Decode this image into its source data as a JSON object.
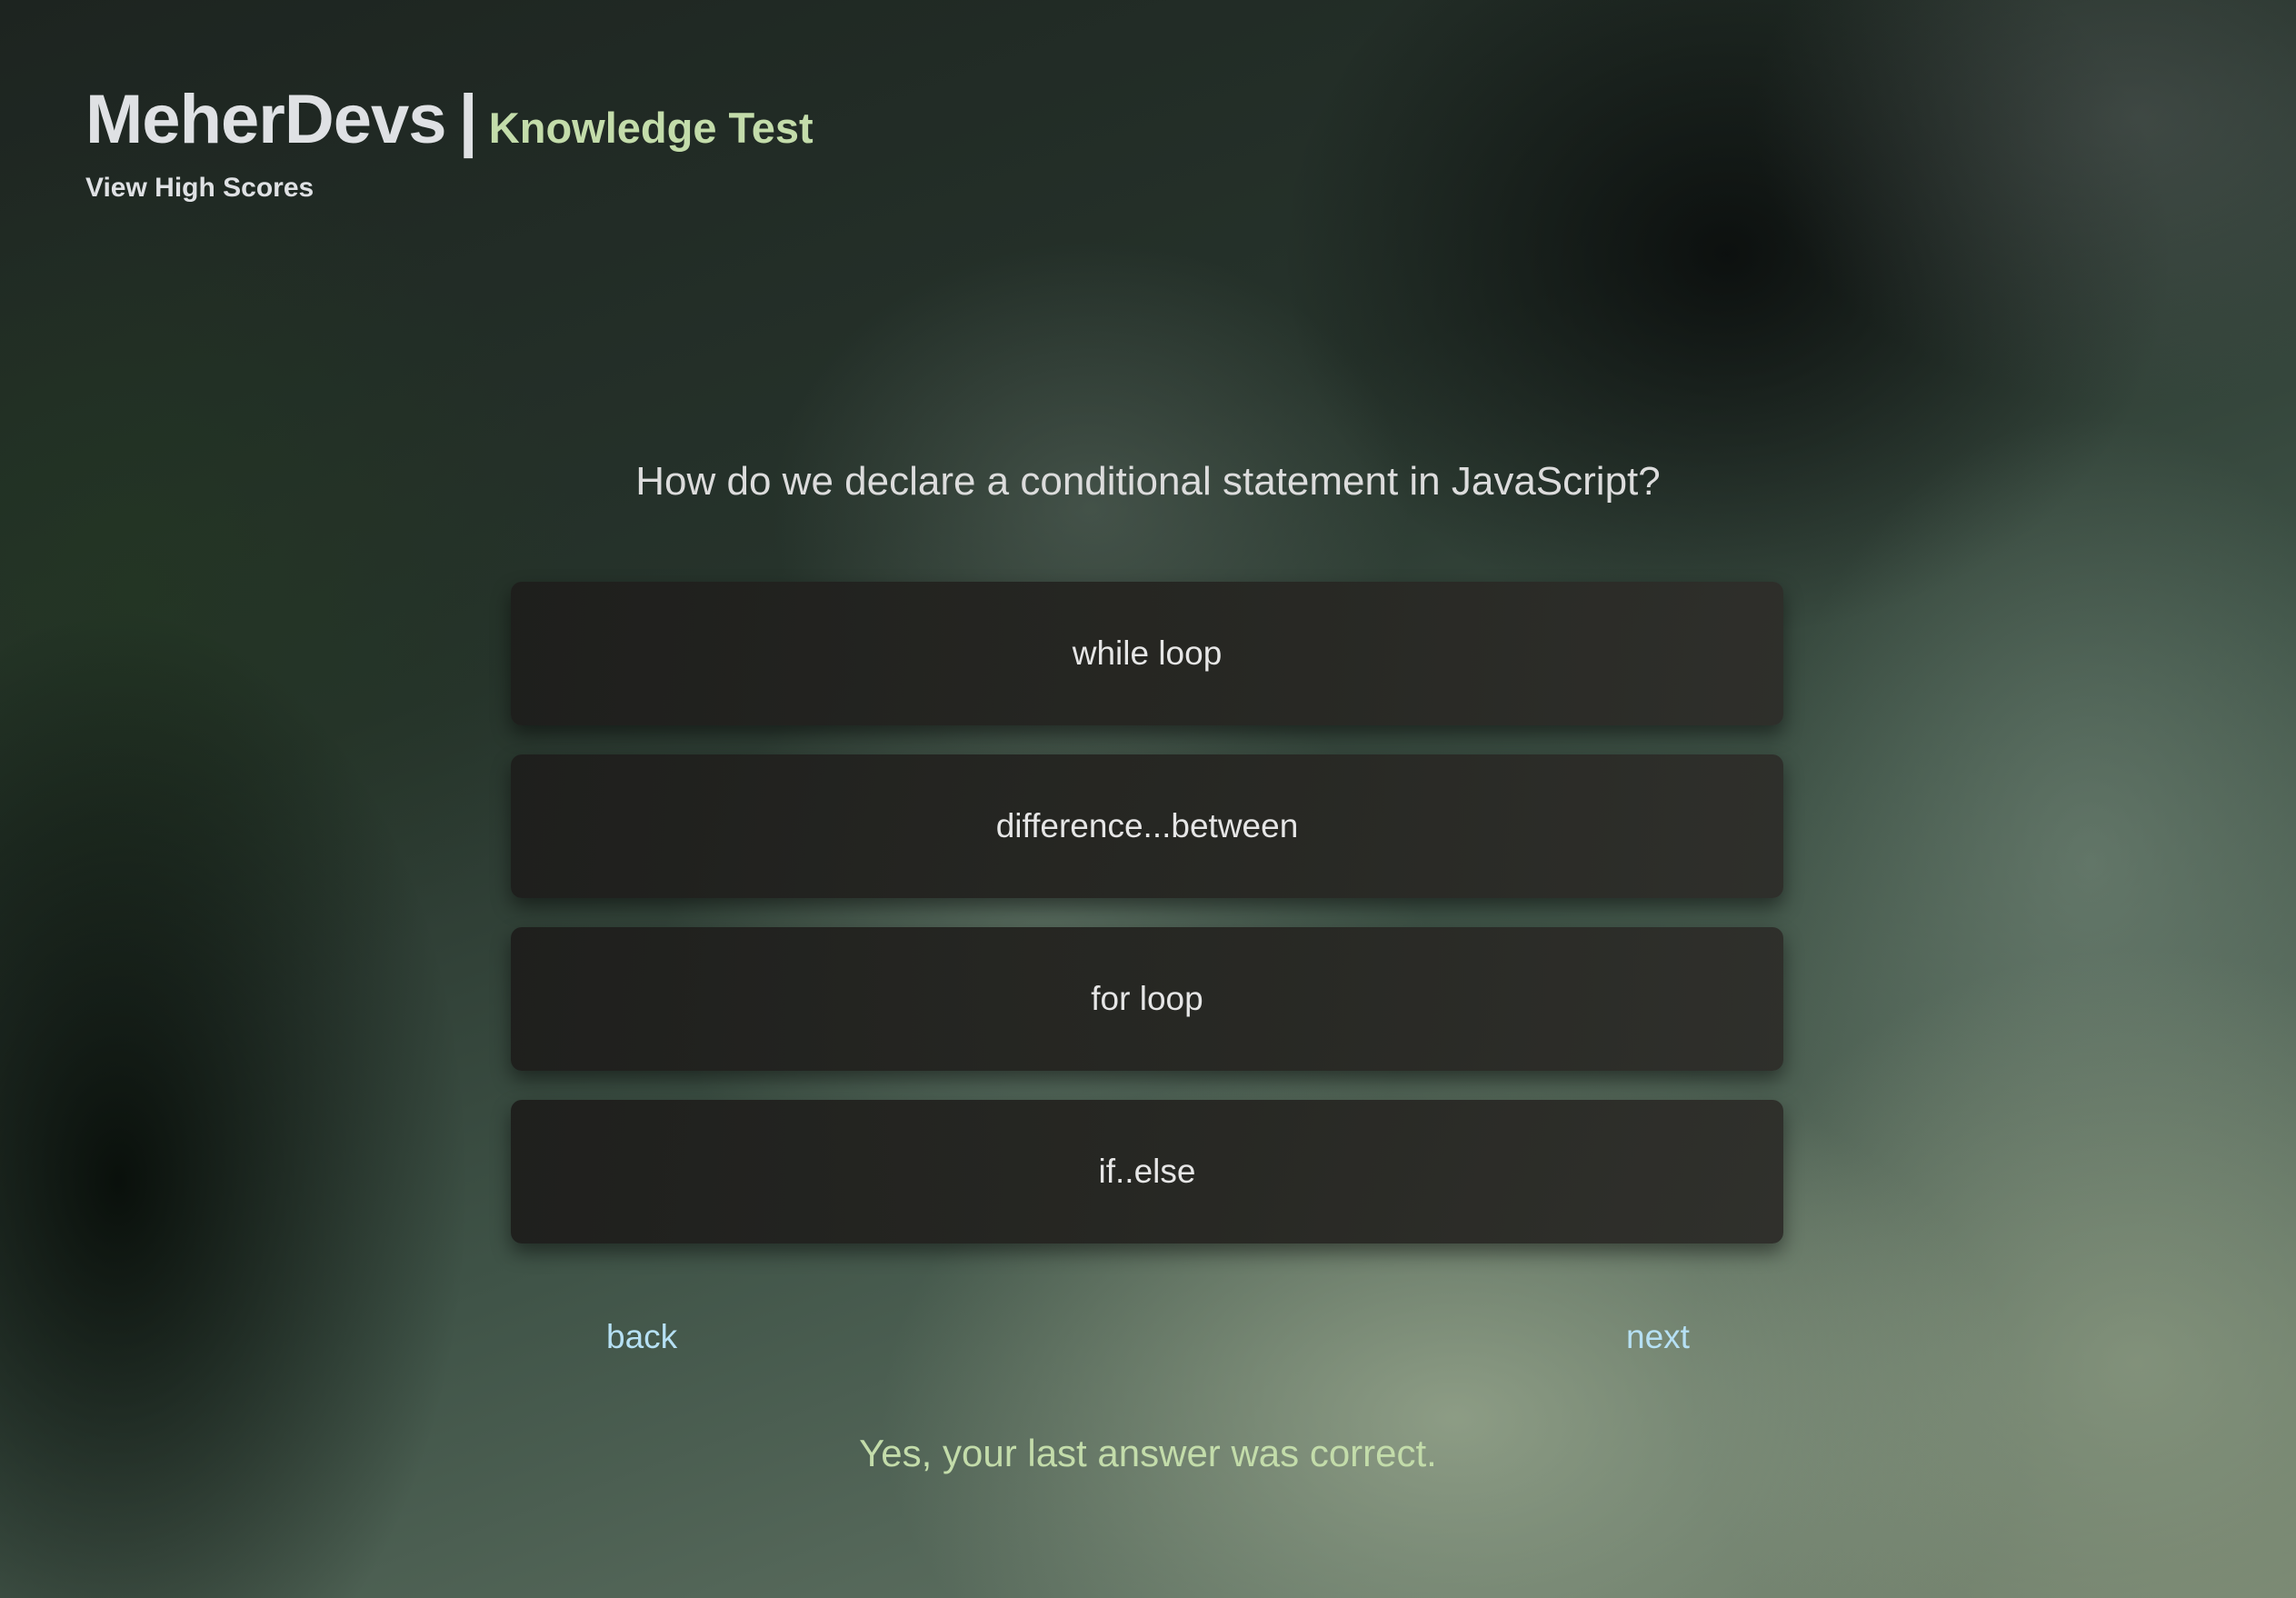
{
  "header": {
    "brand": "MeherDevs",
    "separator": "|",
    "subtitle": "Knowledge Test",
    "high_scores_link": "View High Scores"
  },
  "quiz": {
    "question": "How do we declare a conditional statement in JavaScript?",
    "answers": [
      {
        "label": "while loop"
      },
      {
        "label": "difference...between"
      },
      {
        "label": "for loop"
      },
      {
        "label": "if..else"
      }
    ],
    "nav": {
      "back_label": "back",
      "next_label": "next"
    },
    "feedback": "Yes, your last answer was correct."
  },
  "colors": {
    "brand_text": "#dfe1e4",
    "accent_green": "#c3dcaa",
    "link_blue": "#b6e0f4",
    "answer_bg": "#262622"
  }
}
